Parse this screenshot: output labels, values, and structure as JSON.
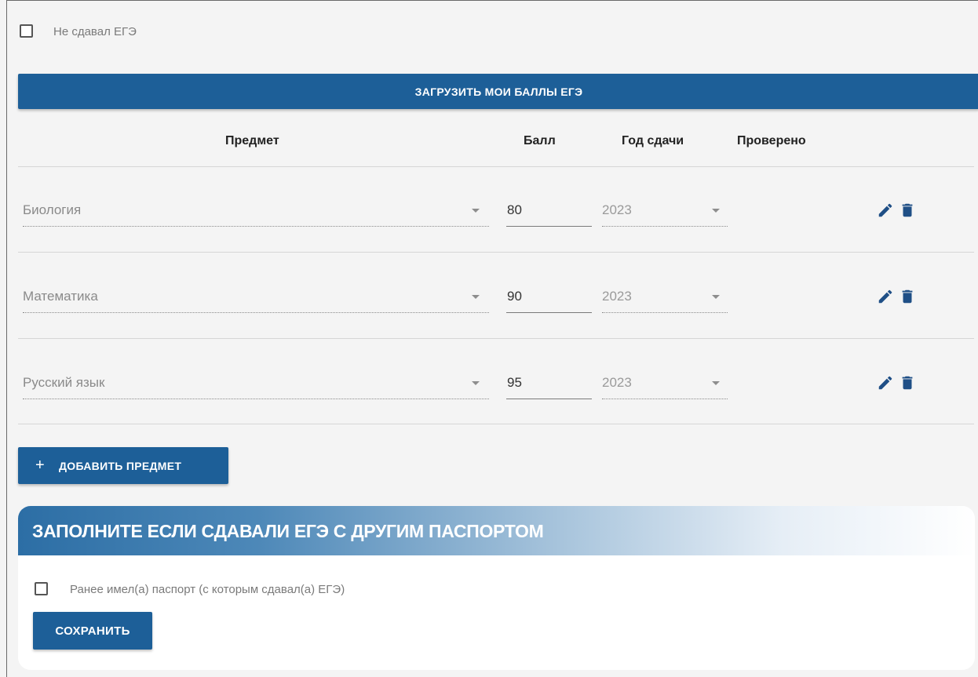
{
  "not_taken": {
    "label": "Не сдавал ЕГЭ",
    "checked": false
  },
  "load_button": {
    "label": "ЗАГРУЗИТЬ МОИ БАЛЛЫ ЕГЭ"
  },
  "table": {
    "headers": {
      "subject": "Предмет",
      "score": "Балл",
      "year": "Год сдачи",
      "verified": "Проверено"
    },
    "rows": [
      {
        "subject": "Биология",
        "score": "80",
        "year": "2023"
      },
      {
        "subject": "Математика",
        "score": "90",
        "year": "2023"
      },
      {
        "subject": "Русский язык",
        "score": "95",
        "year": "2023"
      }
    ],
    "row_icons": [
      "pencil-icon",
      "trash-icon"
    ]
  },
  "add_button": {
    "icon": "+",
    "label": "ДОБАВИТЬ ПРЕДМЕТ"
  },
  "passport_section": {
    "title": "ЗАПОЛНИТЕ ЕСЛИ СДАВАЛИ ЕГЭ С ДРУГИМ ПАСПОРТОМ",
    "checkbox_label": "Ранее имел(а) паспорт (с которым сдавал(а) ЕГЭ)",
    "checkbox_checked": false,
    "save_label": "СОХРАНИТЬ"
  },
  "colors": {
    "primary": "#1d5f98",
    "icon": "#1f4f86"
  }
}
